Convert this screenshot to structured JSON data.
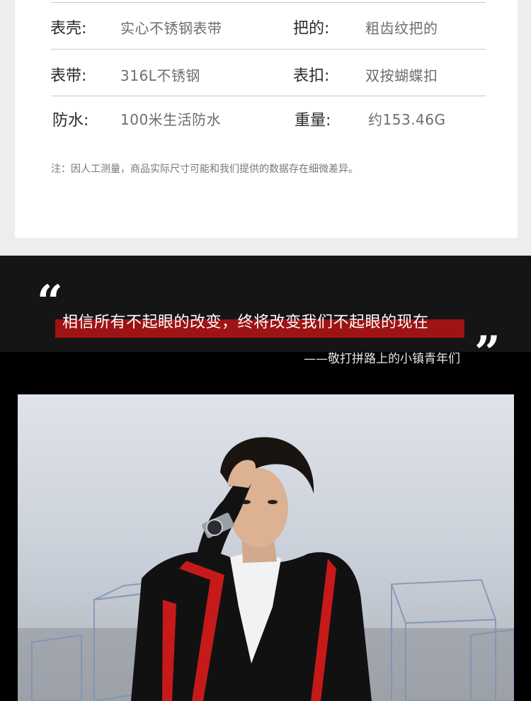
{
  "specs": {
    "rows": [
      {
        "left_label": "表壳:",
        "left_value": "实心不锈钢表带",
        "right_label": "把的:",
        "right_value": "粗齿纹把的"
      },
      {
        "left_label": "表带:",
        "left_value": "316L不锈钢",
        "right_label": "表扣:",
        "right_value": "双按蝴蝶扣"
      },
      {
        "left_label": "防水:",
        "left_value": "100米生活防水",
        "right_label": "重量:",
        "right_value": "约153.46G"
      }
    ],
    "note": "注：因人工测量，商品实际尺寸可能和我们提供的数据存在细微差异。"
  },
  "quote": {
    "open_mark": "“",
    "text": "相信所有不起眼的改变，终将改变我们不起眼的现在",
    "close_mark": "”",
    "author": "——敬打拼路上的小镇青年们"
  },
  "colors": {
    "highlight": "#9e1313",
    "band": "#000000"
  }
}
